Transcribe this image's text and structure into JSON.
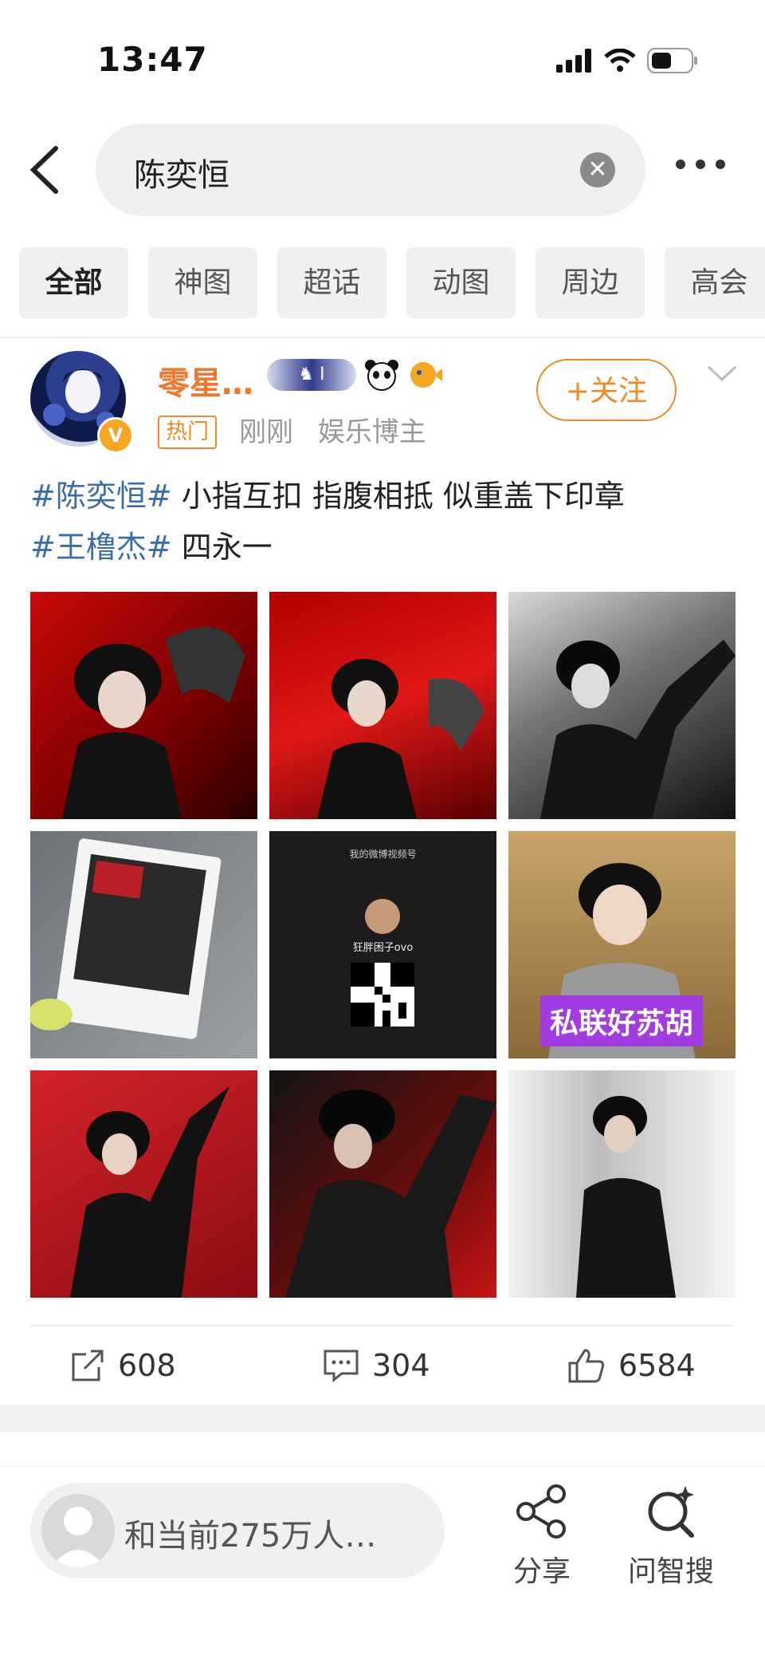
{
  "status_bar": {
    "time": "13:47"
  },
  "search": {
    "query": "陈奕恒"
  },
  "tabs": [
    {
      "label": "全部",
      "active": true
    },
    {
      "label": "神图",
      "active": false
    },
    {
      "label": "超话",
      "active": false
    },
    {
      "label": "动图",
      "active": false
    },
    {
      "label": "周边",
      "active": false
    },
    {
      "label": "高会",
      "active": false
    }
  ],
  "post": {
    "user_name": "零星…",
    "hot_tag": "热门",
    "time": "刚刚",
    "role": "娱乐博主",
    "follow_label": "+关注",
    "text": {
      "topic1": "#陈奕恒#",
      "body1": " 小指互扣 指腹相抵 似重盖下印章",
      "topic2": "#王橹杰#",
      "body2": " 四永一"
    },
    "images": {
      "qr_title": "我的微博视频号",
      "qr_name": "狂胖困子ovo",
      "overlay_text": "私联好苏胡"
    },
    "actions": {
      "repost": "608",
      "comment": "304",
      "like": "6584"
    }
  },
  "bottom_bar": {
    "reading_text": "和当前275万人…",
    "share_label": "分享",
    "ask_label": "问智搜"
  },
  "colors": {
    "accent_orange": "#f08a24",
    "topic_blue": "#3a6ea5",
    "badge_purple": "#a13de0"
  }
}
